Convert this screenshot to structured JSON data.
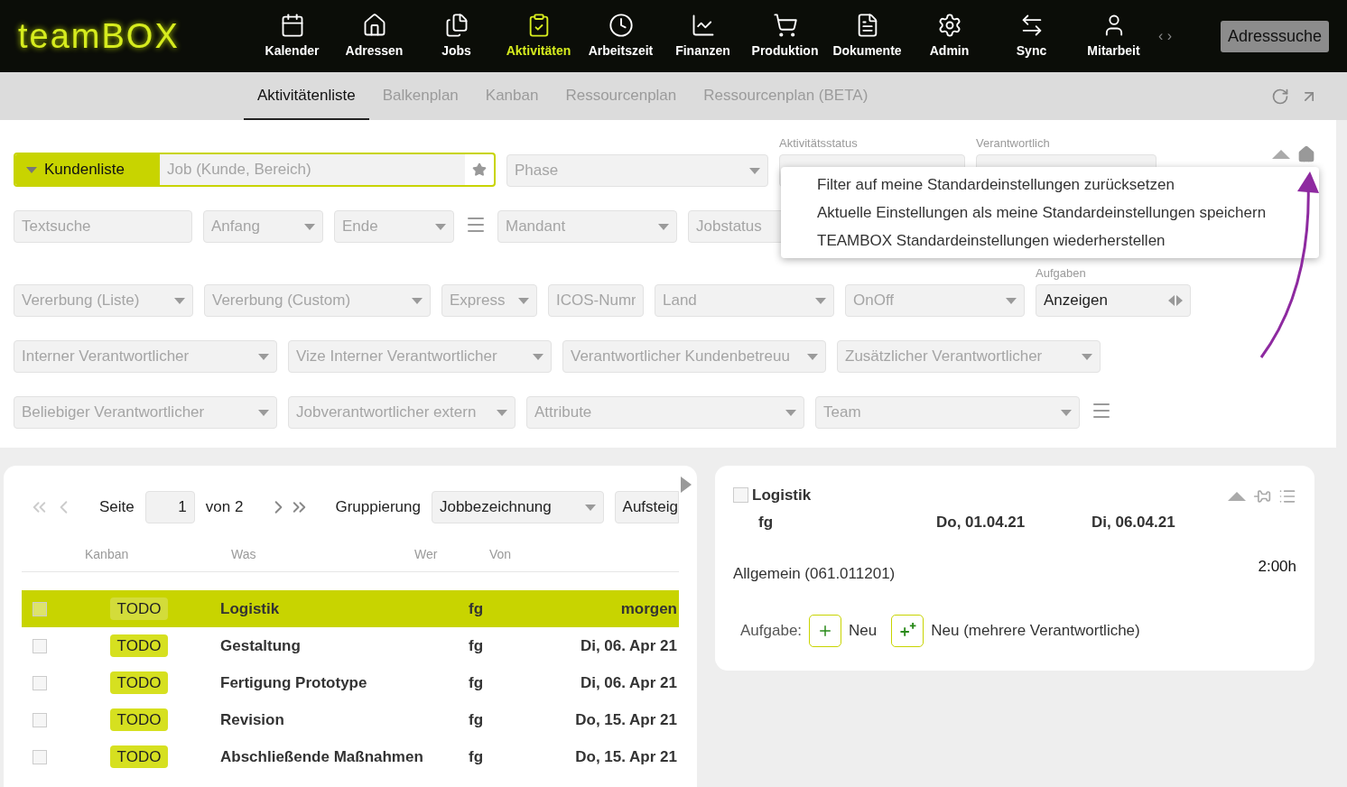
{
  "brand": "teamBOX",
  "nav": [
    {
      "label": "Kalender",
      "selected": false
    },
    {
      "label": "Adressen",
      "selected": false
    },
    {
      "label": "Jobs",
      "selected": false
    },
    {
      "label": "Aktivitäten",
      "selected": true
    },
    {
      "label": "Arbeitszeit",
      "selected": false
    },
    {
      "label": "Finanzen",
      "selected": false
    },
    {
      "label": "Produktion",
      "selected": false
    },
    {
      "label": "Dokumente",
      "selected": false
    },
    {
      "label": "Admin",
      "selected": false
    },
    {
      "label": "Sync",
      "selected": false
    },
    {
      "label": "Mitarbeit",
      "selected": false
    }
  ],
  "nav_arrows": "‹ ›",
  "address_search": "Adresssuche",
  "tabs": [
    {
      "label": "Aktivitätenliste",
      "selected": true
    },
    {
      "label": "Balkenplan",
      "selected": false
    },
    {
      "label": "Kanban",
      "selected": false
    },
    {
      "label": "Ressourcenplan",
      "selected": false
    },
    {
      "label": "Ressourcenplan (BETA)",
      "selected": false
    }
  ],
  "customer_filter": {
    "toggle": "Kundenliste",
    "placeholder": "Job (Kunde, Bereich)"
  },
  "filter_rows": [
    [
      {
        "kind": "select",
        "placeholder": "Phase"
      },
      {
        "kind": "select",
        "label": "Aktivitätsstatus"
      },
      {
        "kind": "select",
        "label": "Verantwortlich"
      }
    ],
    [
      {
        "kind": "text",
        "placeholder": "Textsuche"
      },
      {
        "kind": "select",
        "placeholder": "Anfang"
      },
      {
        "kind": "select",
        "placeholder": "Ende"
      },
      {
        "kind": "menu"
      },
      {
        "kind": "select",
        "placeholder": "Mandant"
      },
      {
        "kind": "text",
        "placeholder": "Jobstatus"
      }
    ],
    [
      {
        "kind": "select",
        "placeholder": "Vererbung (Liste)"
      },
      {
        "kind": "select",
        "placeholder": "Vererbung (Custom)"
      },
      {
        "kind": "select",
        "placeholder": "Express"
      },
      {
        "kind": "text",
        "placeholder": "ICOS-Numr"
      },
      {
        "kind": "select",
        "placeholder": "Land"
      },
      {
        "kind": "select",
        "placeholder": "OnOff"
      },
      {
        "kind": "spinner",
        "label": "Aufgaben",
        "value": "Anzeigen"
      }
    ],
    [
      {
        "kind": "select",
        "placeholder": "Interner Verantwortlicher"
      },
      {
        "kind": "select",
        "placeholder": "Vize Interner Verantwortlicher"
      },
      {
        "kind": "select",
        "placeholder": "Verantwortlicher Kundenbetreuu"
      },
      {
        "kind": "select",
        "placeholder": "Zusätzlicher Verantwortlicher"
      }
    ],
    [
      {
        "kind": "select",
        "placeholder": "Beliebiger Verantwortlicher"
      },
      {
        "kind": "select",
        "placeholder": "Jobverantwortlicher extern"
      },
      {
        "kind": "select",
        "placeholder": "Attribute"
      },
      {
        "kind": "select",
        "placeholder": "Team"
      },
      {
        "kind": "menu"
      }
    ]
  ],
  "settings_menu": [
    "Filter auf meine Standardeinstellungen zurücksetzen",
    "Aktuelle Einstellungen als meine Standardeinstellungen speichern",
    "TEAMBOX Standardeinstellungen wiederherstellen"
  ],
  "pager": {
    "page_label": "Seite",
    "page": "1",
    "of": "von 2",
    "grouping_label": "Gruppierung",
    "grouping": "Jobbezeichnung",
    "sort": "Aufsteig"
  },
  "table": {
    "columns": [
      "Kanban",
      "Was",
      "Wer",
      "Von"
    ],
    "rows": [
      {
        "selected": true,
        "checked": false,
        "status": "TODO",
        "what": "Logistik",
        "who": "fg",
        "from": "morgen"
      },
      {
        "selected": false,
        "checked": false,
        "status": "TODO",
        "what": "Gestaltung",
        "who": "fg",
        "from": "Di, 06. Apr 21"
      },
      {
        "selected": false,
        "checked": false,
        "status": "TODO",
        "what": "Fertigung Prototype",
        "who": "fg",
        "from": "Di, 06. Apr 21"
      },
      {
        "selected": false,
        "checked": false,
        "status": "TODO",
        "what": "Revision",
        "who": "fg",
        "from": "Do, 15. Apr 21"
      },
      {
        "selected": false,
        "checked": false,
        "status": "TODO",
        "what": "Abschließende Maßnahmen",
        "who": "fg",
        "from": "Do, 15. Apr 21"
      }
    ]
  },
  "detail": {
    "checked": false,
    "title": "Logistik",
    "who": "fg",
    "start": "Do, 01.04.21",
    "end": "Di, 06.04.21",
    "job": "Allgemein (061.011201)",
    "duration": "2:00h",
    "task_label": "Aufgabe:",
    "new": "Neu",
    "new_multi": "Neu (mehrere Verantwortliche)"
  }
}
